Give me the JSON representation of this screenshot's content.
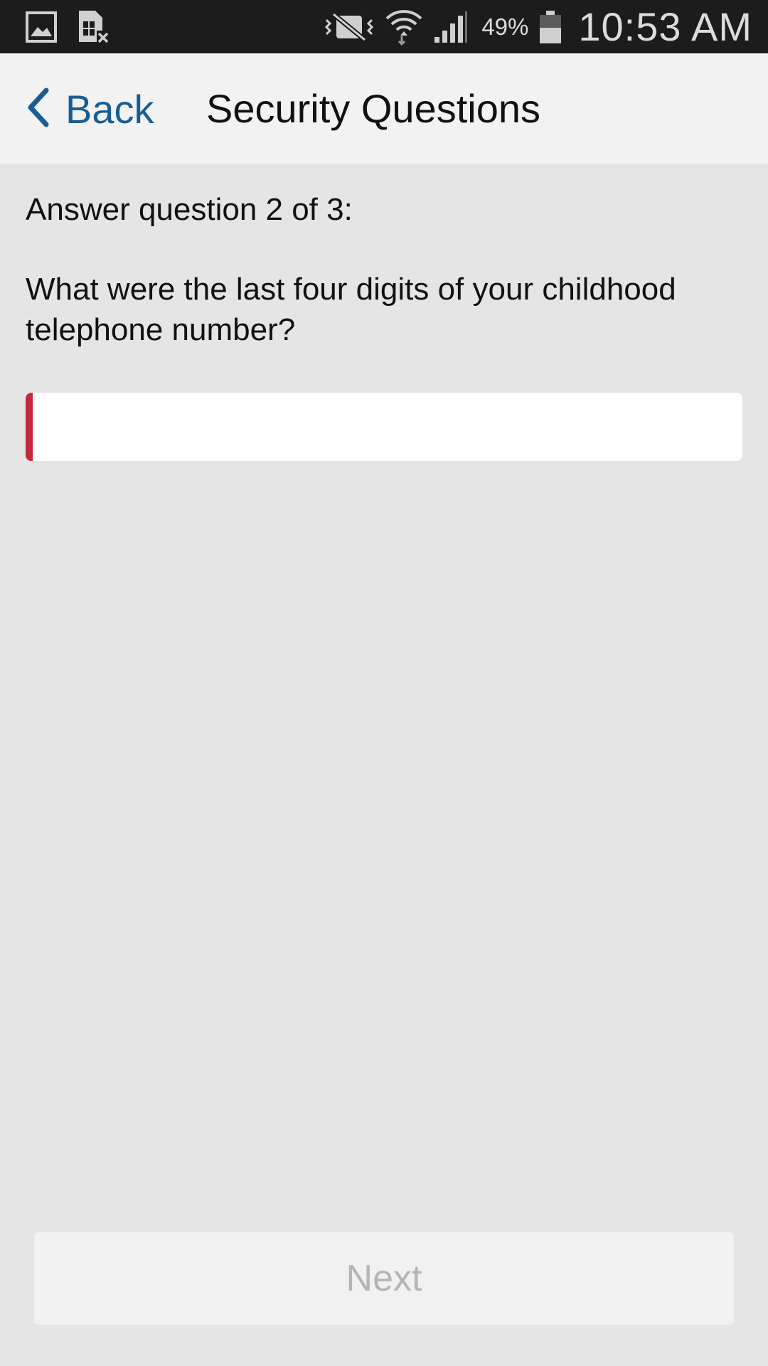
{
  "status_bar": {
    "left_icons": [
      "gallery-icon",
      "sim-card-error-icon"
    ],
    "right_icons": [
      "vibrate-mute-icon",
      "wifi-icon",
      "cell-signal-icon",
      "battery-icon"
    ],
    "battery_percent": "49%",
    "time": "10:53 AM"
  },
  "header": {
    "back_label": "Back",
    "title": "Security Questions"
  },
  "question": {
    "counter": "Answer question 2 of 3:",
    "text": "What were the last four digits of your childhood telephone number?",
    "answer_value": "",
    "answer_placeholder": ""
  },
  "footer": {
    "next_label": "Next"
  },
  "colors": {
    "accent_blue": "#1a5d94",
    "error_red": "#c9283a",
    "background": "#e5e5e5",
    "header_background": "#f2f2f2",
    "status_bar_background": "#1c1c1c"
  }
}
